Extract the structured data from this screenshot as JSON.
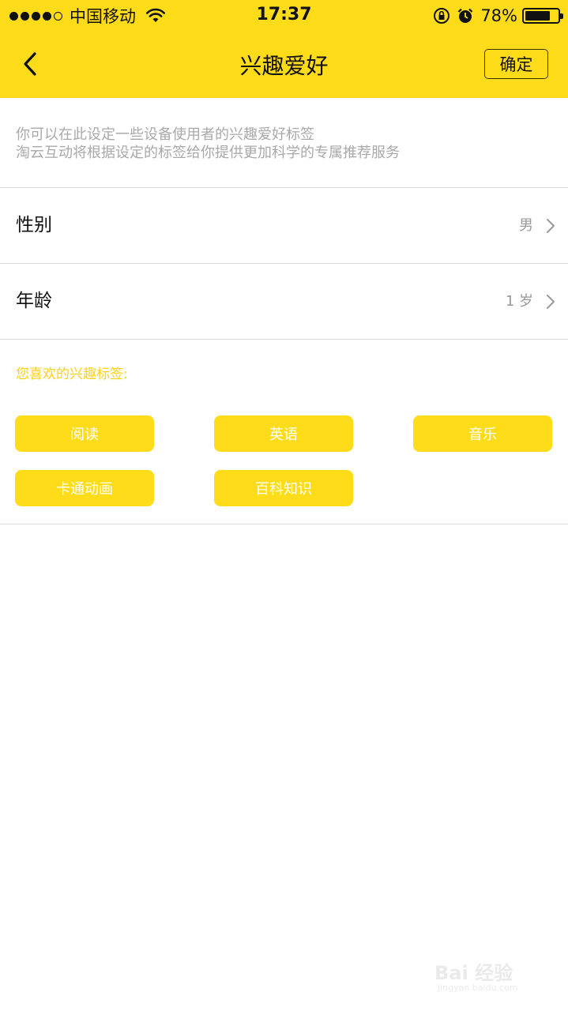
{
  "status_bar": {
    "carrier": "中国移动",
    "time": "17:37",
    "battery_percent": "78%",
    "battery_level": 0.78,
    "signal_bars": 4,
    "icons": [
      "signal-icon",
      "wifi-icon",
      "rotation-lock-icon",
      "alarm-icon",
      "battery-icon"
    ]
  },
  "nav": {
    "title": "兴趣爱好",
    "back_icon": "chevron-left-icon",
    "confirm_label": "确定"
  },
  "description": {
    "line1": "你可以在此设定一些设备使用者的兴趣爱好标签",
    "line2": "淘云互动将根据设定的标签给你提供更加科学的专属推荐服务"
  },
  "settings": {
    "gender": {
      "label": "性别",
      "value": "男"
    },
    "age": {
      "label": "年龄",
      "value": "1 岁"
    }
  },
  "interests": {
    "title": "您喜欢的兴趣标签:",
    "tags": [
      "阅读",
      "英语",
      "音乐",
      "卡通动画",
      "百科知识"
    ]
  },
  "watermark": {
    "main": "Bai 经验",
    "sub": "jingyan.baidu.com"
  },
  "colors": {
    "accent": "#fedc1a",
    "tag_title": "#fdd116",
    "description": "#a9a9a9"
  }
}
